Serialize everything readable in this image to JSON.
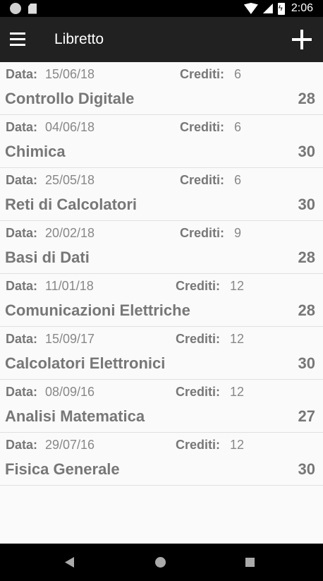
{
  "status_bar": {
    "time": "2:06"
  },
  "toolbar": {
    "title": "Libretto",
    "menu_icon": "hamburger-menu-icon",
    "add_icon": "plus-icon"
  },
  "labels": {
    "data": "Data:",
    "crediti": "Crediti:"
  },
  "exams": [
    {
      "date": "15/06/18",
      "credits": "6",
      "name": "Controllo Digitale",
      "grade": "28"
    },
    {
      "date": "04/06/18",
      "credits": "6",
      "name": "Chimica",
      "grade": "30"
    },
    {
      "date": "25/05/18",
      "credits": "6",
      "name": "Reti di Calcolatori",
      "grade": "30"
    },
    {
      "date": "20/02/18",
      "credits": "9",
      "name": "Basi di Dati",
      "grade": "28"
    },
    {
      "date": "11/01/18",
      "credits": "12",
      "name": "Comunicazioni Elettriche",
      "grade": "28"
    },
    {
      "date": "15/09/17",
      "credits": "12",
      "name": "Calcolatori Elettronici",
      "grade": "30"
    },
    {
      "date": "08/09/16",
      "credits": "12",
      "name": "Analisi Matematica",
      "grade": "27"
    },
    {
      "date": "29/07/16",
      "credits": "12",
      "name": "Fisica Generale",
      "grade": "30"
    }
  ],
  "nav_bar": {
    "back_icon": "back-triangle-icon",
    "home_icon": "home-circle-icon",
    "recents_icon": "recents-square-icon"
  }
}
